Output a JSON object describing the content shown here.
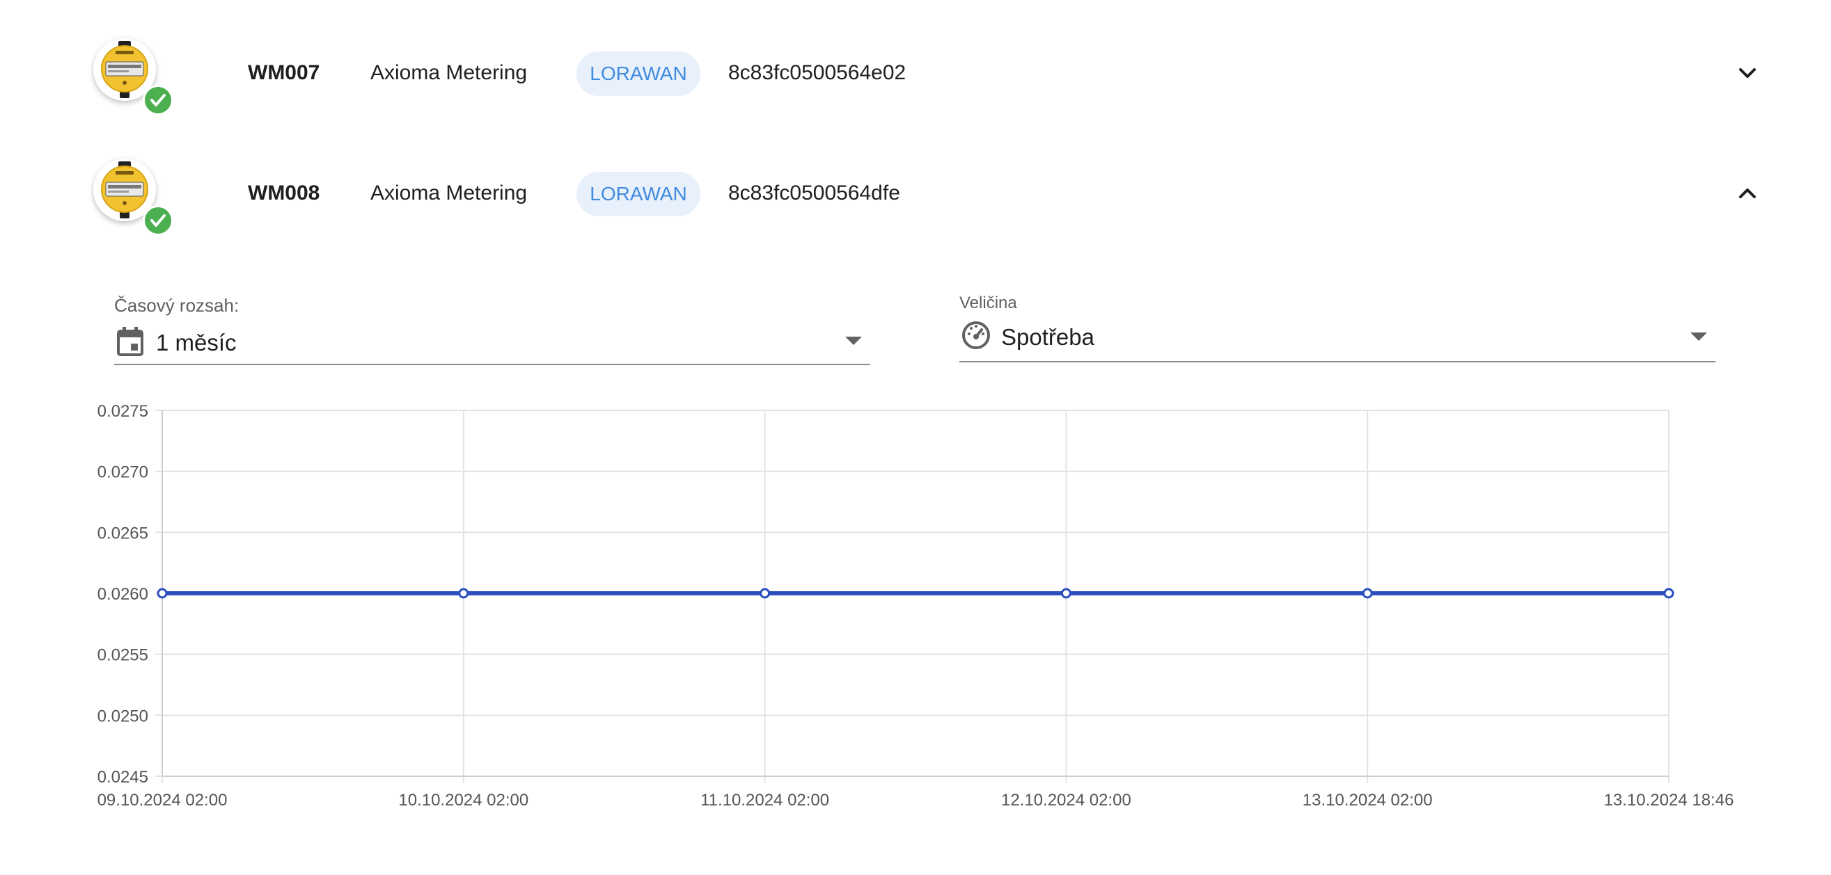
{
  "devices": [
    {
      "name": "WM007",
      "vendor": "Axioma Metering",
      "network": "LORAWAN",
      "eui": "8c83fc0500564e02",
      "expanded": false,
      "status_icon": "check-circle-icon",
      "toggle_icon": "chevron-down-icon"
    },
    {
      "name": "WM008",
      "vendor": "Axioma Metering",
      "network": "LORAWAN",
      "eui": "8c83fc0500564dfe",
      "expanded": true,
      "status_icon": "check-circle-icon",
      "toggle_icon": "chevron-up-icon"
    }
  ],
  "filters": {
    "time_range": {
      "label": "Časový rozsah:",
      "value": "1 měsíc",
      "icon": "calendar-icon"
    },
    "quantity": {
      "label": "Veličina",
      "value": "Spotřeba",
      "icon": "speedometer-icon"
    }
  },
  "colors": {
    "chip_background": "#e8f0fb",
    "chip_text": "#3f8be0",
    "status_ok": "#4caf50",
    "series_line": "#2b4fbf"
  },
  "chart_data": {
    "type": "line",
    "x": [
      "09.10.2024 02:00",
      "10.10.2024 02:00",
      "11.10.2024 02:00",
      "12.10.2024 02:00",
      "13.10.2024 02:00",
      "13.10.2024 18:46"
    ],
    "series": [
      {
        "values": [
          0.026,
          0.026,
          0.026,
          0.026,
          0.026,
          0.026
        ]
      }
    ],
    "ylim": [
      0.0245,
      0.0275
    ],
    "yticks": [
      "0.0275",
      "0.0270",
      "0.0265",
      "0.0260",
      "0.0255",
      "0.0250",
      "0.0245"
    ],
    "grid": true,
    "legend": "none",
    "title": "",
    "xlabel": "",
    "ylabel": ""
  }
}
